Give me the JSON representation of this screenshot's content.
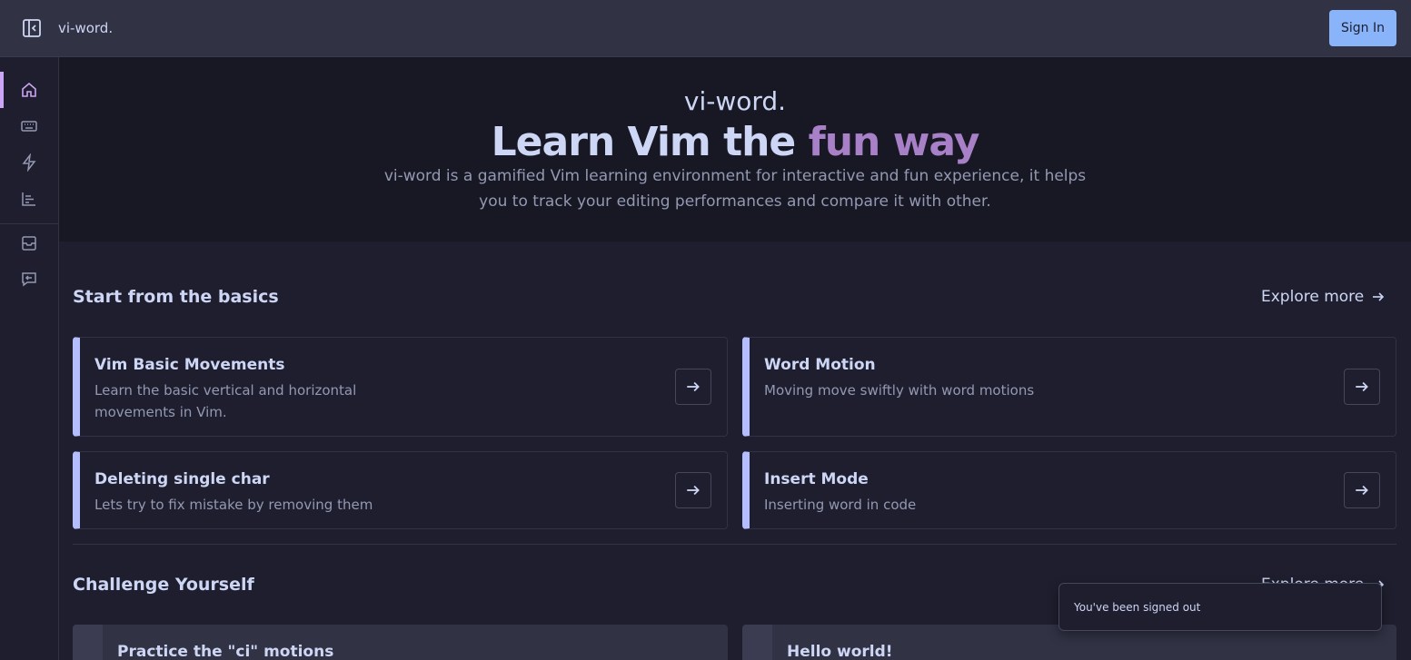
{
  "header": {
    "brand": "vi-word.",
    "signin_label": "Sign In"
  },
  "sidebar": {
    "items": [
      "home",
      "keyboard",
      "bolt",
      "chart",
      "inbox",
      "feedback"
    ]
  },
  "hero": {
    "brand": "vi-word.",
    "title_main": "Learn Vim the ",
    "title_accent": "fun way",
    "description": "vi-word is a gamified Vim learning environment for interactive and fun experience, it helps you to track your editing performances and compare it with other."
  },
  "basics": {
    "title": "Start from the basics",
    "explore_label": "Explore more",
    "cards": [
      {
        "title": "Vim Basic Movements",
        "desc": "Learn the basic vertical and horizontal movements in Vim."
      },
      {
        "title": "Word Motion",
        "desc": "Moving move swiftly with word motions"
      },
      {
        "title": "Deleting single char",
        "desc": "Lets try to fix mistake by removing them"
      },
      {
        "title": "Insert Mode",
        "desc": "Inserting word in code"
      }
    ]
  },
  "challenge": {
    "title": "Challenge Yourself",
    "cards": [
      {
        "title": "Practice the \"ci\" motions"
      },
      {
        "title": "Hello world!"
      }
    ]
  },
  "toast": {
    "message": "You've been signed out"
  },
  "colors": {
    "accent": "#a880c7",
    "card_border": "#b4befe",
    "signin_bg": "#89b4fa"
  }
}
